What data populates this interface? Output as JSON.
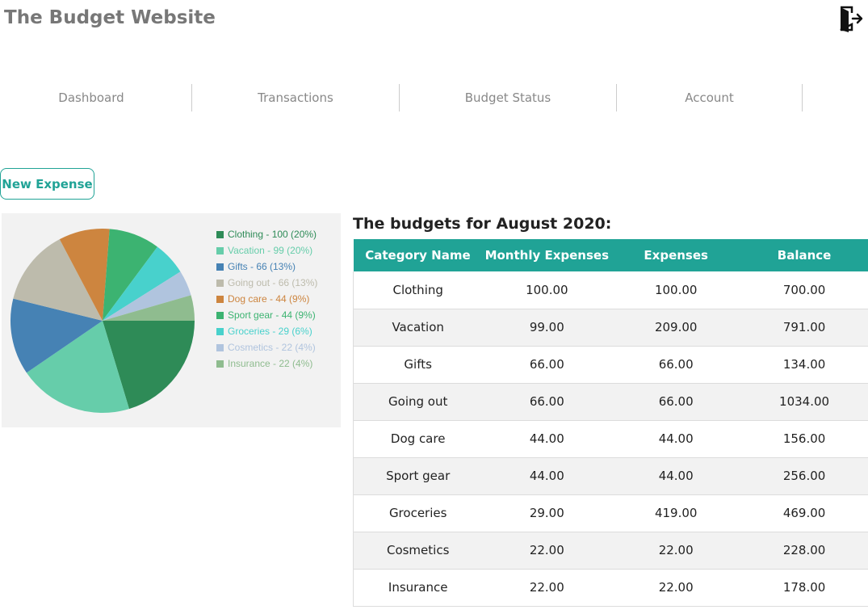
{
  "site": {
    "title": "The Budget Website",
    "logout_icon": "logout-door-icon"
  },
  "nav": {
    "items": [
      {
        "label": "Dashboard",
        "active": true
      },
      {
        "label": "Transactions",
        "active": false
      },
      {
        "label": "Budget Status",
        "active": false
      },
      {
        "label": "Account",
        "active": false
      }
    ]
  },
  "actions": {
    "new_expense_label": "New Expense"
  },
  "chart_data": {
    "type": "pie",
    "categories": [
      "Clothing",
      "Vacation",
      "Gifts",
      "Going out",
      "Dog care",
      "Sport gear",
      "Groceries",
      "Cosmetics",
      "Insurance"
    ],
    "values": [
      100,
      99,
      66,
      66,
      44,
      44,
      29,
      22,
      22
    ],
    "percentages": [
      20,
      20,
      13,
      13,
      9,
      9,
      6,
      4,
      4
    ],
    "colors": [
      "#2e8b57",
      "#66cdaa",
      "#4682b4",
      "#bdbbac",
      "#cd853f",
      "#3cb371",
      "#48d1cc",
      "#b0c4de",
      "#8fbc8f"
    ],
    "legend_labels": [
      "Clothing - 100 (20%)",
      "Vacation - 99 (20%)",
      "Gifts - 66 (13%)",
      "Going out - 66 (13%)",
      "Dog care - 44 (9%)",
      "Sport gear - 44 (9%)",
      "Groceries - 29 (6%)",
      "Cosmetics - 22 (4%)",
      "Insurance - 22 (4%)"
    ],
    "legend_position": "right"
  },
  "budgets": {
    "heading": "The budgets for August 2020:",
    "columns": [
      "Category Name",
      "Monthly Expenses",
      "Expenses",
      "Balance"
    ],
    "rows": [
      [
        "Clothing",
        "100.00",
        "100.00",
        "700.00"
      ],
      [
        "Vacation",
        "99.00",
        "209.00",
        "791.00"
      ],
      [
        "Gifts",
        "66.00",
        "66.00",
        "134.00"
      ],
      [
        "Going out",
        "66.00",
        "66.00",
        "1034.00"
      ],
      [
        "Dog care",
        "44.00",
        "44.00",
        "156.00"
      ],
      [
        "Sport gear",
        "44.00",
        "44.00",
        "256.00"
      ],
      [
        "Groceries",
        "29.00",
        "419.00",
        "469.00"
      ],
      [
        "Cosmetics",
        "22.00",
        "22.00",
        "228.00"
      ],
      [
        "Insurance",
        "22.00",
        "22.00",
        "178.00"
      ]
    ]
  }
}
